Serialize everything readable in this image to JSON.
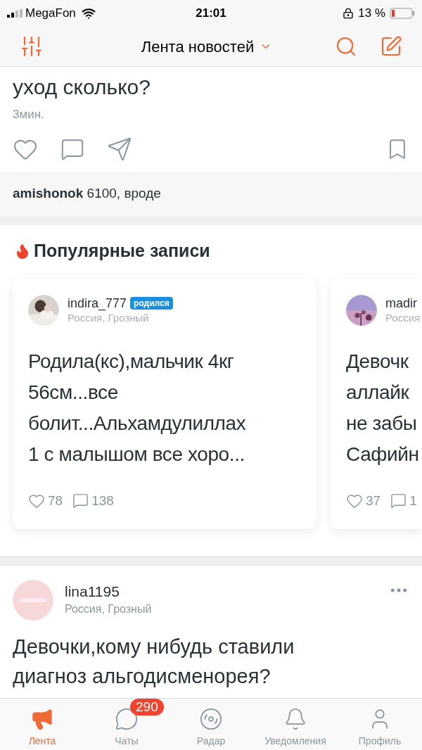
{
  "status_bar": {
    "carrier": "MegaFon",
    "time": "21:01",
    "battery": "13 %"
  },
  "header": {
    "title": "Лента новостей"
  },
  "post_top": {
    "title": "уход сколько?",
    "time": "3мин.",
    "comment": {
      "author": "amishonok",
      "text": "6100, вроде"
    }
  },
  "popular": {
    "title": "Популярные записи",
    "cards": [
      {
        "author": "indira_777",
        "badge": "родился",
        "location": "Россия, Грозный",
        "lines": [
          "Родила(кс),мальчик 4кг",
          "56см...все",
          "болит...Альхамдулиллах",
          "1 с малышом все хоро..."
        ],
        "likes": "78",
        "comments": "138"
      },
      {
        "author": "madir",
        "location": "Россия",
        "lines": [
          "Девочк",
          "аллайк",
          "не забы",
          "Сафийн"
        ],
        "likes": "37",
        "comments": "1"
      }
    ]
  },
  "post": {
    "author": "lina1195",
    "location": "Россия, Грозный",
    "text": "Девочки,кому нибудь ставили диагноз альгодисменорея?"
  },
  "tabs": [
    {
      "label": "Лента",
      "selected": true
    },
    {
      "label": "Чаты",
      "selected": false,
      "badge": "290"
    },
    {
      "label": "Радар",
      "selected": false
    },
    {
      "label": "Уведомления",
      "selected": false
    },
    {
      "label": "Профиль",
      "selected": false
    }
  ]
}
